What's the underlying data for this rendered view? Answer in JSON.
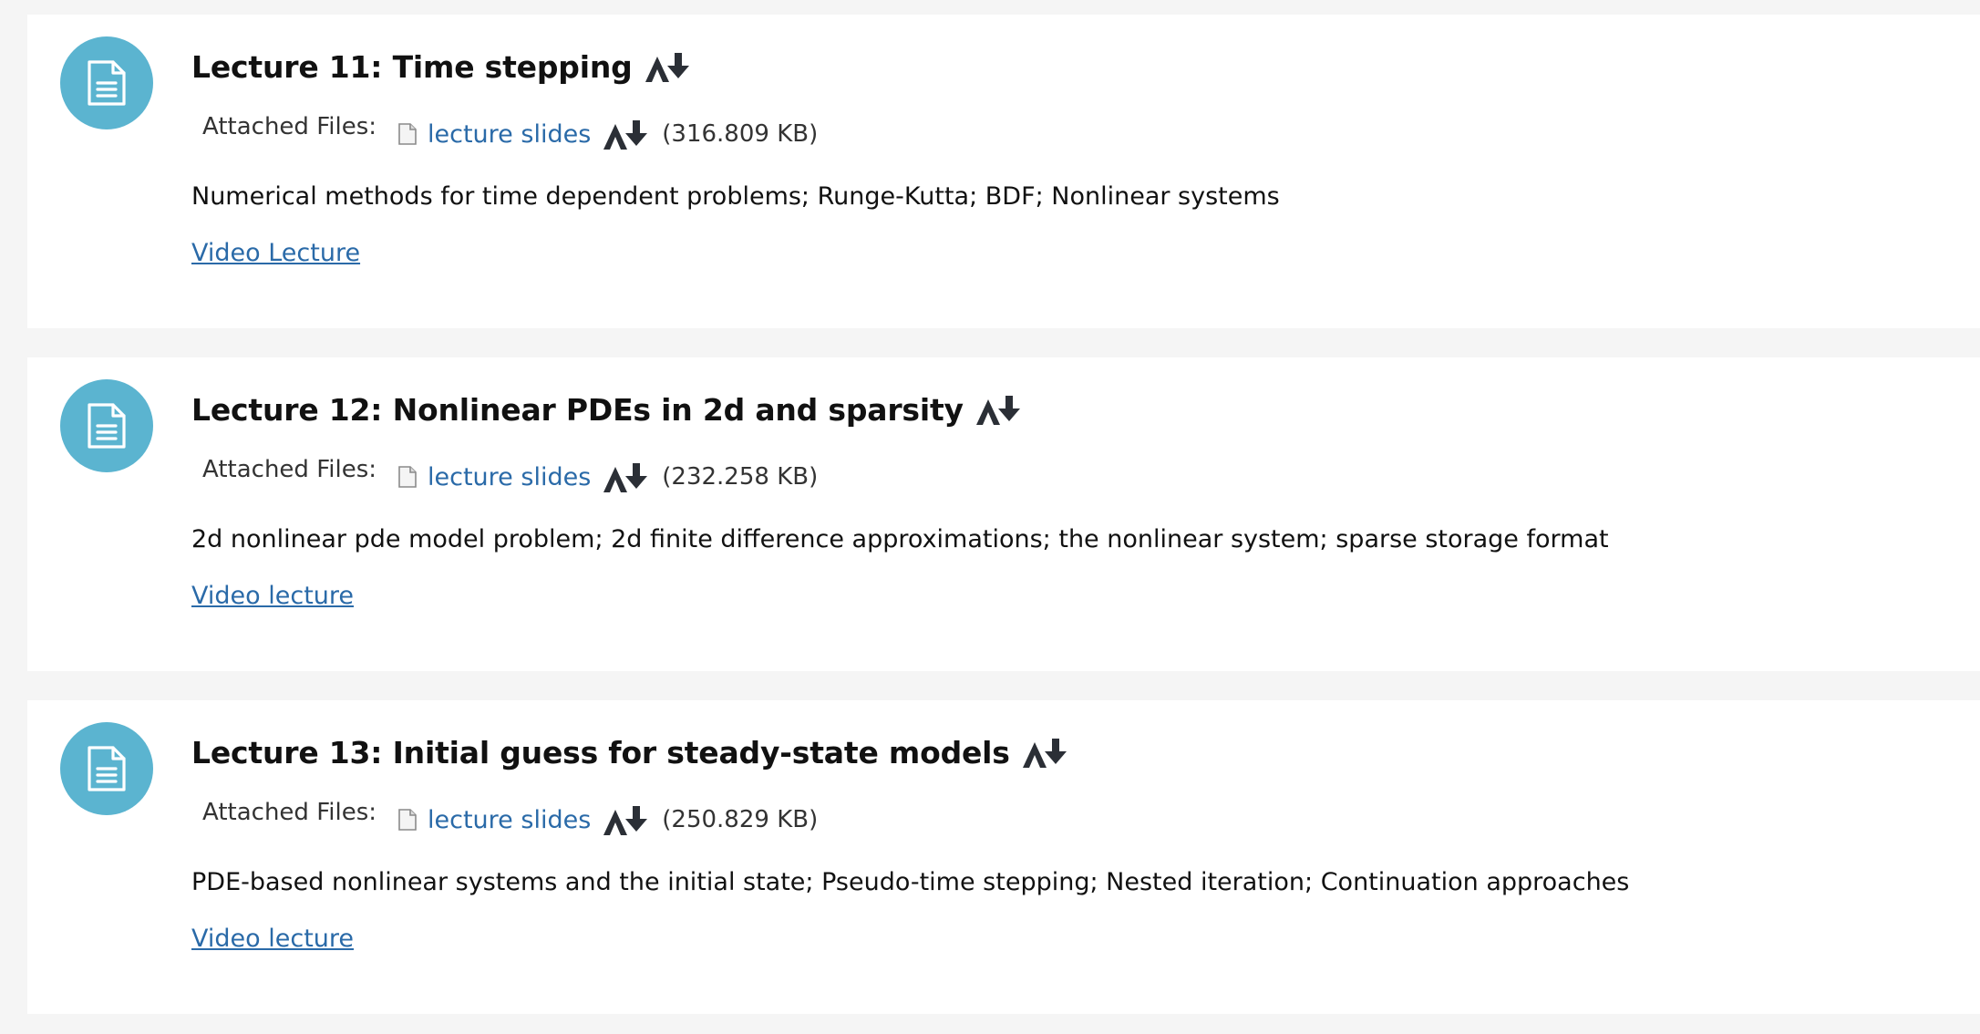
{
  "colors": {
    "page_background": "#f5f5f5",
    "card_background": "#ffffff",
    "activity_icon": "#5bb4d0",
    "link": "#2a6aa8",
    "text": "#111111"
  },
  "lectures": [
    {
      "title": "Lecture 11: Time stepping",
      "files_label": "Attached Files:",
      "file_link": "lecture slides",
      "file_size": "(316.809 KB)",
      "description": "Numerical methods for time dependent problems; Runge-Kutta; BDF; Nonlinear systems",
      "video_link": "Video Lecture",
      "icons": [
        "document-icon",
        "accessibility-download-icon",
        "file-icon"
      ]
    },
    {
      "title": "Lecture 12: Nonlinear PDEs in 2d and sparsity",
      "files_label": "Attached Files:",
      "file_link": "lecture slides",
      "file_size": "(232.258 KB)",
      "description": "2d nonlinear pde model problem; 2d finite difference approximations; the nonlinear system; sparse storage format",
      "video_link": "Video lecture",
      "icons": [
        "document-icon",
        "accessibility-download-icon",
        "file-icon"
      ]
    },
    {
      "title": "Lecture 13: Initial guess for steady-state models",
      "files_label": "Attached Files:",
      "file_link": "lecture slides",
      "file_size": "(250.829 KB)",
      "description": "PDE-based nonlinear systems and the initial state; Pseudo-time stepping; Nested iteration; Continuation approaches",
      "video_link": "Video lecture",
      "icons": [
        "document-icon",
        "accessibility-download-icon",
        "file-icon"
      ]
    }
  ]
}
